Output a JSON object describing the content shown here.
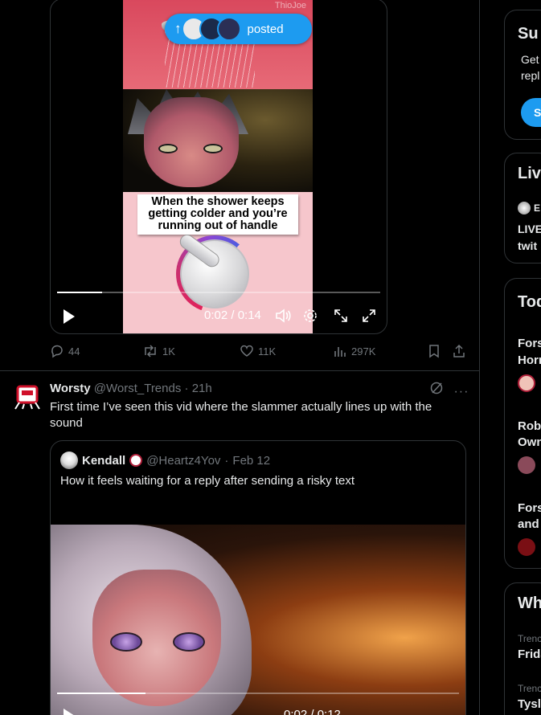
{
  "tweet1": {
    "watermark": "ThioJoe",
    "meme_caption": "When the shower keeps getting colder and you’re running out of handle",
    "video": {
      "time": "0:02 / 0:14",
      "progress": 0.14,
      "play_icon": "play-icon",
      "volume_icon": "volume-icon",
      "settings_icon": "gear-icon",
      "pip_icon": "picture-in-picture-icon",
      "fullscreen_icon": "fullscreen-icon"
    },
    "actions": {
      "replies": "44",
      "reposts": "1K",
      "likes": "11K",
      "views": "297K"
    }
  },
  "posted_pill": {
    "label": "posted",
    "avatar_colors": [
      "#e9e9e9",
      "#1b2a4a",
      "#2b2f55"
    ]
  },
  "tweet2": {
    "name": "Worsty",
    "handle": "@Worst_Trends",
    "time": "21h",
    "text": "First time I’ve seen this vid where the slammer actually lines up with the sound",
    "quote": {
      "name": "Kendall",
      "handle": "@Heartz4Yov",
      "date": "Feb 12",
      "text": "How it feels waiting for a reply after sending a risky text",
      "progress": 0.22,
      "time": "0:02 / 0:12"
    }
  },
  "sidebar": {
    "subscribe": {
      "title": "Su",
      "line1": "Get",
      "line2": "repl",
      "button": "S"
    },
    "live": {
      "title": "Liv",
      "host_initial": "E",
      "item_line1": "LIVE",
      "item_line2": "twit"
    },
    "today": {
      "title": "Tod",
      "items": [
        {
          "line1": "Fors",
          "line2": "Horn"
        },
        {
          "line1": "Rob",
          "line2": "Own"
        },
        {
          "line1": "Fors",
          "line2": "and"
        }
      ]
    },
    "whats": {
      "title": "Wh",
      "trends": [
        {
          "context": "Trenc",
          "name": "Frida"
        },
        {
          "context": "Trenc",
          "name": "Tysl"
        }
      ]
    }
  },
  "colors": {
    "accent": "#1d9bf0",
    "background": "#000000",
    "border": "#2f3336",
    "muted": "#71767b"
  }
}
